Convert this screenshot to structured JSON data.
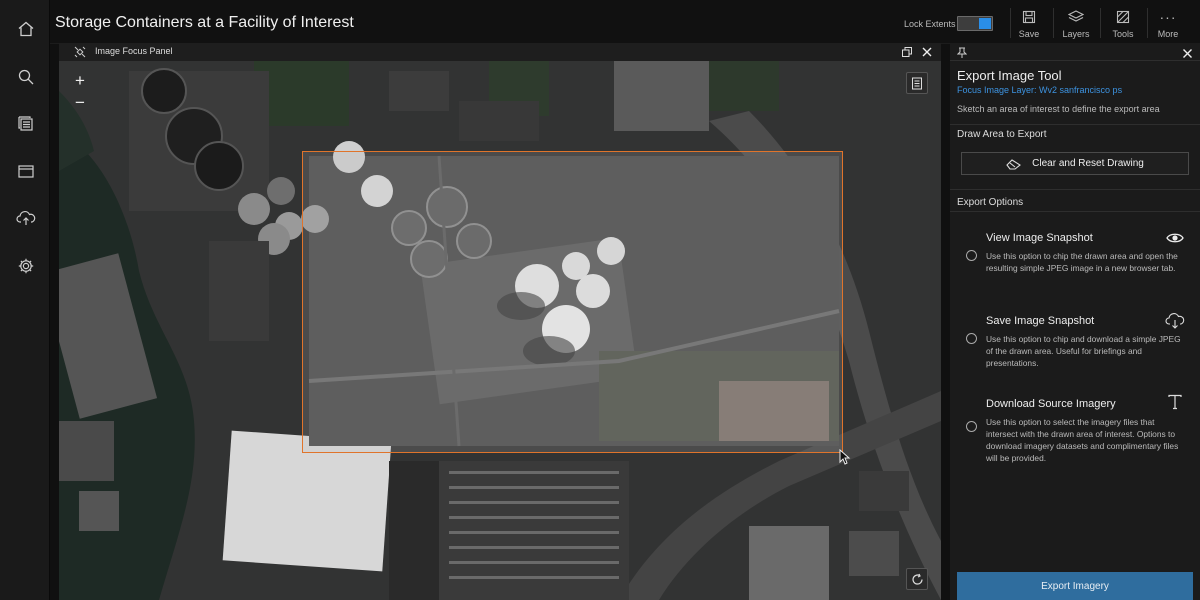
{
  "app": {
    "title": "Storage Containers at a Facility of Interest"
  },
  "sidebar": {
    "items": [
      {
        "icon": "home-icon"
      },
      {
        "icon": "search-icon"
      },
      {
        "icon": "layers-list-icon"
      },
      {
        "icon": "folder-icon"
      },
      {
        "icon": "cloud-upload-icon"
      },
      {
        "icon": "gear-icon"
      }
    ]
  },
  "toolbar": {
    "lock_label": "Lock Extents",
    "lock_on": true,
    "save_label": "Save",
    "layers_label": "Layers",
    "tools_label": "Tools",
    "more_label": "More"
  },
  "map_panel": {
    "title": "Image Focus Panel",
    "zoom_in": "+",
    "zoom_out": "−"
  },
  "export_tool": {
    "title": "Export Image Tool",
    "layer_link": "Focus Image Layer: Wv2 sanfrancisco ps",
    "hint": "Sketch an area of interest to define the export area",
    "draw_section": "Draw Area to Export",
    "clear_button": "Clear and Reset Drawing",
    "options_section": "Export Options",
    "options": [
      {
        "title": "View Image Snapshot",
        "description": "Use this option to chip the drawn area and open the resulting simple JPEG image in a new browser tab.",
        "icon": "eye-icon"
      },
      {
        "title": "Save Image Snapshot",
        "description": "Use this option to chip and download a simple JPEG of the drawn area. Useful for briefings and presentations.",
        "icon": "cloud-download-icon"
      },
      {
        "title": "Download Source Imagery",
        "description": "Use this option to select the imagery files that intersect with the drawn area of interest. Options to download imagery datasets and complimentary files will be provided.",
        "icon": "text-tool-icon"
      }
    ],
    "export_button": "Export Imagery"
  },
  "colors": {
    "accent": "#2a8ee8",
    "selection": "#e0742b",
    "export_button": "#2f6d9e",
    "link": "#3d93e0"
  }
}
